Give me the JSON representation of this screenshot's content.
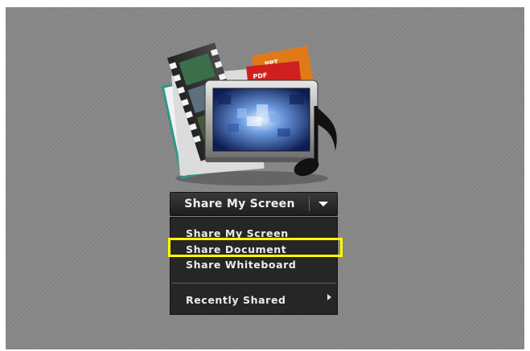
{
  "share_graphic": {
    "icon": "share-media-icon",
    "doc_labels": [
      "PPT",
      "PDF"
    ]
  },
  "share_button": {
    "label": "Share My Screen",
    "dropdown_icon": "chevron-down-icon"
  },
  "menu": {
    "items": [
      {
        "label": "Share My Screen"
      },
      {
        "label": "Share Document",
        "highlighted": true
      },
      {
        "label": "Share Whiteboard"
      }
    ],
    "recent": {
      "label": "Recently Shared",
      "submenu_icon": "chevron-right-icon"
    }
  },
  "colors": {
    "pod_background": "#858585",
    "menu_background": "#262626",
    "highlight": "#ffff00"
  }
}
